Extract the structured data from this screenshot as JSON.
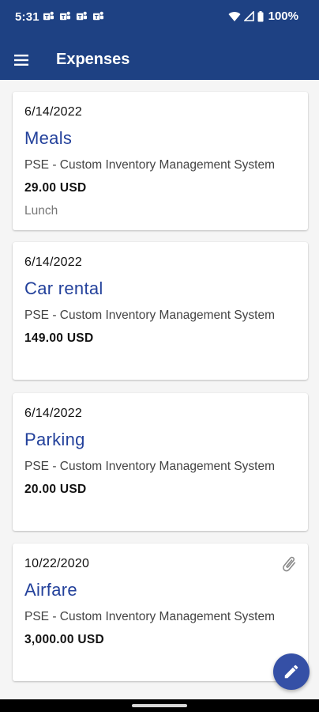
{
  "status_bar": {
    "time": "5:31",
    "battery": "100%",
    "notification_icons": [
      "teams-icon",
      "teams-icon",
      "teams-icon",
      "teams-icon"
    ]
  },
  "header": {
    "title": "Expenses",
    "menu_icon": "hamburger-menu-icon",
    "color": "#1e4183"
  },
  "expenses": [
    {
      "date": "6/14/2022",
      "category": "Meals",
      "project": "PSE - Custom Inventory Management System",
      "amount": "29.00 USD",
      "note": "Lunch",
      "has_attachment": false
    },
    {
      "date": "6/14/2022",
      "category": "Car rental",
      "project": "PSE - Custom Inventory Management System",
      "amount": "149.00 USD",
      "has_attachment": false
    },
    {
      "date": "6/14/2022",
      "category": "Parking",
      "project": "PSE - Custom Inventory Management System",
      "amount": "20.00 USD",
      "has_attachment": false
    },
    {
      "date": "10/22/2020",
      "category": "Airfare",
      "project": "PSE - Custom Inventory Management System",
      "amount": "3,000.00 USD",
      "has_attachment": true
    }
  ],
  "fab": {
    "icon": "pencil-icon",
    "color": "#3550a6"
  },
  "colors": {
    "accent": "#23419b",
    "background": "#f5f5f5"
  }
}
